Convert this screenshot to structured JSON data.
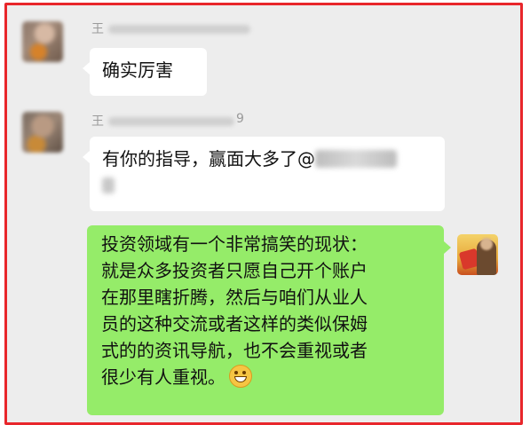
{
  "messages": [
    {
      "sender": "王",
      "text": "确实厉害"
    },
    {
      "sender": "王",
      "name_suffix": "9",
      "text": "有你的指导，赢面大多了@"
    },
    {
      "lines": [
        "投资领域有一个非常搞笑的现状：",
        "就是众多投资者只愿自己开个账户",
        "在那里瞎折腾，然后与咱们从业人",
        "员的这种交流或者这样的类似保姆",
        "式的的资讯导航，也不会重视或者",
        "很少有人重视。"
      ],
      "emoji": "grinning-face-icon"
    }
  ],
  "colors": {
    "frame": "#e8262b",
    "background": "#ededed",
    "incoming_bubble": "#ffffff",
    "outgoing_bubble": "#95ec69"
  }
}
